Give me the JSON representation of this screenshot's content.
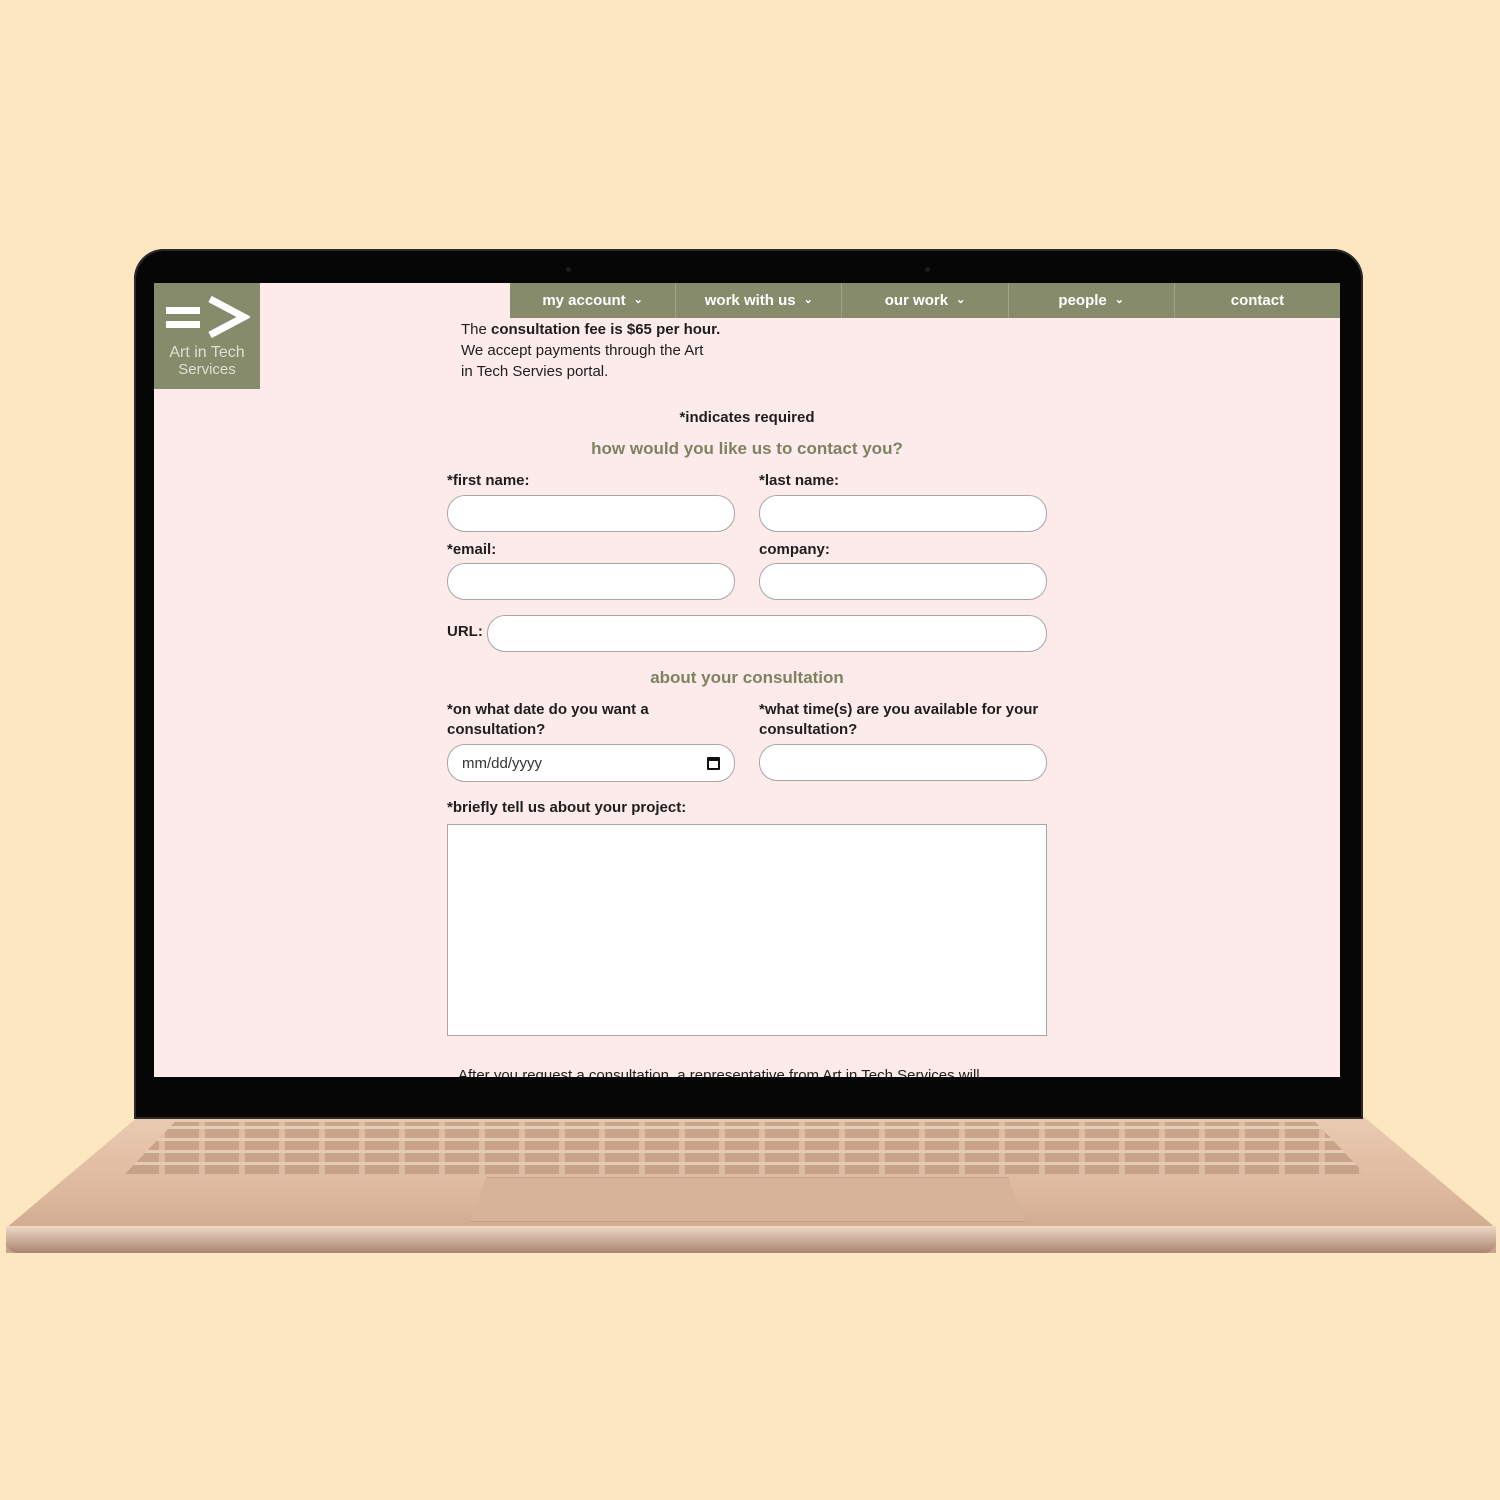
{
  "brand": {
    "line1": "Art in Tech",
    "line2": "Services"
  },
  "nav": [
    {
      "label": "my account",
      "has_dropdown": true
    },
    {
      "label": "work with us",
      "has_dropdown": true
    },
    {
      "label": "our work",
      "has_dropdown": true
    },
    {
      "label": "people",
      "has_dropdown": true
    },
    {
      "label": "contact",
      "has_dropdown": false
    }
  ],
  "intro": {
    "prefix": "The ",
    "fee_bold": "consultation fee is $65 per hour",
    "suffix": ".",
    "line2": "We accept payments through the Art",
    "line3": "in Tech Servies portal."
  },
  "form": {
    "required_note": "*indicates required",
    "contact_heading": "how would you like us to contact you?",
    "first_name_label": "*first name:",
    "last_name_label": "*last name:",
    "email_label": "*email:",
    "company_label": "company:",
    "url_label": "URL:",
    "consult_heading": "about your consultation",
    "date_label_1": "*on what date do you want a",
    "date_label_2": "consultation?",
    "date_placeholder": "mm/dd/yyyy",
    "time_label_1": "*what time(s) are you available for your",
    "time_label_2": "consultation?",
    "project_label": "*briefly tell us about your project:",
    "footer_text": "After you request a consultation, a representative from Art in Tech Services will"
  },
  "colors": {
    "page_bg": "#fde7c1",
    "screen_bg": "#fdeaea",
    "accent": "#868b6b",
    "heading": "#7d8262"
  }
}
